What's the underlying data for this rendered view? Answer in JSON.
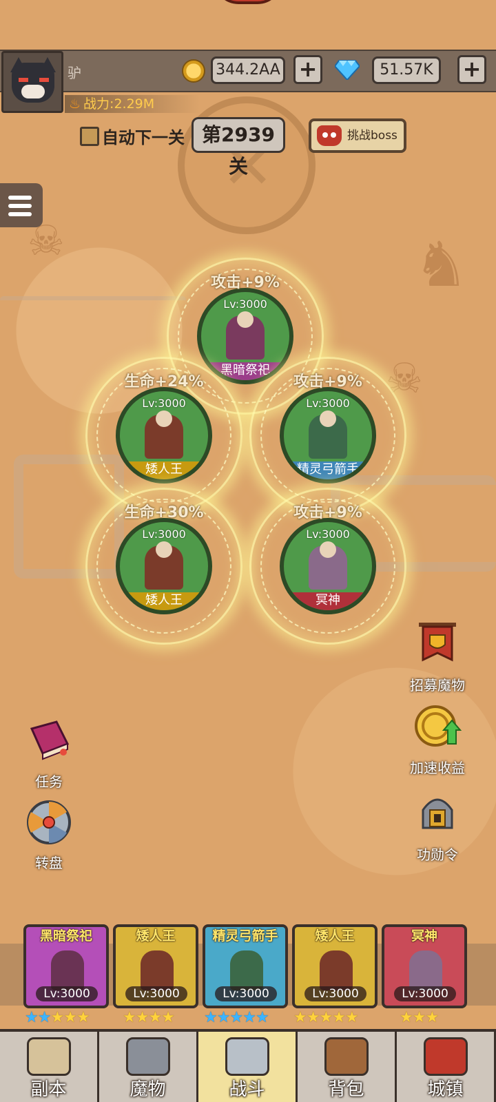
{
  "player": {
    "name": "驴",
    "power": "战力:2.29M",
    "avatar": "cat-avatar"
  },
  "resources": {
    "coins": "344.2AA",
    "gems": "51.57K",
    "plus": "+"
  },
  "stage": {
    "auto_label": "自动下一关",
    "level": "第2939关",
    "boss_button": "挑战boss"
  },
  "formation": [
    {
      "buff": "攻击+9%",
      "level": "Lv:3000",
      "name": "黑暗祭祀",
      "name_bg": "#9b3d8a",
      "fig_color": "#7a3a5e"
    },
    {
      "buff": "生命+24%",
      "level": "Lv:3000",
      "name": "矮人王",
      "name_bg": "#c79a10",
      "fig_color": "#7b3b2a"
    },
    {
      "buff": "攻击+9%",
      "level": "Lv:3000",
      "name": "精灵弓箭手",
      "name_bg": "#3f86b8",
      "fig_color": "#3c6a4a"
    },
    {
      "buff": "生命+30%",
      "level": "Lv:3000",
      "name": "矮人王",
      "name_bg": "#c79a10",
      "fig_color": "#7b3b2a"
    },
    {
      "buff": "攻击+9%",
      "level": "Lv:3000",
      "name": "冥神",
      "name_bg": "#b0303a",
      "fig_color": "#8a6a8a"
    }
  ],
  "side_actions": {
    "recruit": "招募魔物",
    "speedup": "加速收益",
    "merit": "功勋令",
    "quest": "任务",
    "wheel": "转盘"
  },
  "roster": [
    {
      "name": "黑暗祭祀",
      "level": "Lv:3000",
      "bg": "#b44fb8",
      "fig": "#6a3354",
      "stars_blue": 2,
      "stars_yellow": 3
    },
    {
      "name": "矮人王",
      "level": "Lv:3000",
      "bg": "#d9b43a",
      "fig": "#7b3b2a",
      "stars_blue": 0,
      "stars_yellow": 4
    },
    {
      "name": "精灵弓箭手",
      "level": "Lv:3000",
      "bg": "#4aa9c9",
      "fig": "#3c6a4a",
      "stars_blue": 5,
      "stars_yellow": 0
    },
    {
      "name": "矮人王",
      "level": "Lv:3000",
      "bg": "#d9b43a",
      "fig": "#7b3b2a",
      "stars_blue": 0,
      "stars_yellow": 5
    },
    {
      "name": "冥神",
      "level": "Lv:3000",
      "bg": "#c94b58",
      "fig": "#8a6a8a",
      "stars_blue": 0,
      "stars_yellow": 3
    }
  ],
  "nav": [
    {
      "label": "副本",
      "icon": "map-icon"
    },
    {
      "label": "魔物",
      "icon": "helmet-icon"
    },
    {
      "label": "战斗",
      "icon": "swords-icon"
    },
    {
      "label": "背包",
      "icon": "backpack-icon"
    },
    {
      "label": "城镇",
      "icon": "shop-icon"
    }
  ],
  "active_tab": "战斗"
}
